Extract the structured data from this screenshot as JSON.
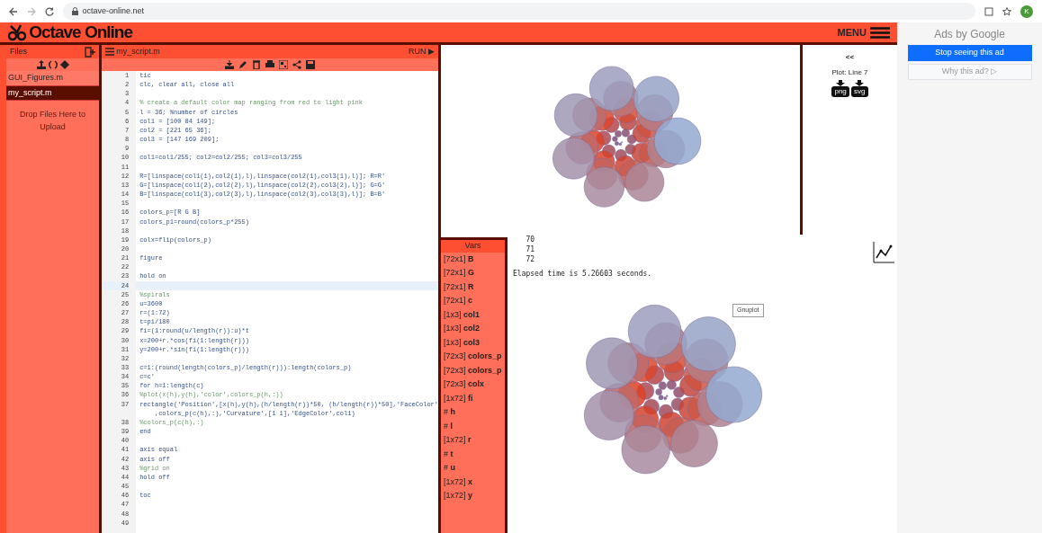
{
  "browser": {
    "url": "octave-online.net",
    "profile_initial": "K"
  },
  "header": {
    "logo": "Octave Online",
    "menu": "MENU"
  },
  "files": {
    "title": "Files",
    "items": [
      {
        "name": "GUI_Figures.m",
        "selected": false
      },
      {
        "name": "my_script.m",
        "selected": true
      }
    ],
    "drop_hint": "Drop Files Here to Upload"
  },
  "editor": {
    "tab": "my_script.m",
    "run": "RUN ▶",
    "lines": [
      {
        "num": "1",
        "kind": "code",
        "text": "tic"
      },
      {
        "num": "2",
        "kind": "code",
        "text": "clc, clear all, close all"
      },
      {
        "num": "3"
      },
      {
        "num": "4",
        "kind": "comment",
        "text": "% create a default color map ranging from red to light pink"
      },
      {
        "num": "5",
        "kind": "code",
        "text": "l = 36; %number of circles"
      },
      {
        "num": "6",
        "kind": "code",
        "text": "col1 = [100 84 149];"
      },
      {
        "num": "7",
        "kind": "code",
        "text": "col2 = [221 65 36];"
      },
      {
        "num": "8",
        "kind": "code",
        "text": "col3 = [147 169 209];"
      },
      {
        "num": "9"
      },
      {
        "num": "10",
        "kind": "code",
        "text": "col1=col1/255; col2=col2/255; col3=col3/255"
      },
      {
        "num": "11"
      },
      {
        "num": "12",
        "kind": "code",
        "text": "R=[linspace(col1(1),col2(1),l),linspace(col2(1),col3(1),l)]; R=R'"
      },
      {
        "num": "13",
        "kind": "code",
        "text": "G=[linspace(col1(2),col2(2),l),linspace(col2(2),col3(2),l)]; G=G'"
      },
      {
        "num": "14",
        "kind": "code",
        "text": "B=[linspace(col1(3),col2(3),l),linspace(col2(3),col3(3),l)]; B=B'"
      },
      {
        "num": "15"
      },
      {
        "num": "16",
        "kind": "code",
        "text": "colors_p=[R G B]"
      },
      {
        "num": "17",
        "kind": "code",
        "text": "colors_p1=round(colors_p*255)"
      },
      {
        "num": "18"
      },
      {
        "num": "19",
        "kind": "code",
        "text": "colx=flip(colors_p)"
      },
      {
        "num": "20"
      },
      {
        "num": "21",
        "kind": "code",
        "text": "figure"
      },
      {
        "num": "22"
      },
      {
        "num": "23",
        "kind": "code",
        "text": "hold on"
      },
      {
        "num": "24",
        "current": true
      },
      {
        "num": "25",
        "kind": "comment",
        "text": "%spirals"
      },
      {
        "num": "26",
        "kind": "code",
        "text": "u=3600"
      },
      {
        "num": "27",
        "kind": "code",
        "text": "r=(1:72)"
      },
      {
        "num": "28",
        "kind": "code",
        "text": "t=pi/180"
      },
      {
        "num": "29",
        "kind": "code",
        "text": "fi=(1:round(u/length(r)):u)*t"
      },
      {
        "num": "30",
        "kind": "code",
        "text": "x=200+r.*cos(fi(1:length(r)))"
      },
      {
        "num": "31",
        "kind": "code",
        "text": "y=200+r.*sin(fi(1:length(r)))"
      },
      {
        "num": "32"
      },
      {
        "num": "33",
        "kind": "code",
        "text": "c=1:(round(length(colors_p)/length(r))):length(colors_p)"
      },
      {
        "num": "34",
        "kind": "code",
        "text": "c=c'"
      },
      {
        "num": "35",
        "kind": "code",
        "text": "for h=1:length(c)"
      },
      {
        "num": "36",
        "kind": "comment",
        "text": "%plot(x(h),y(h),'color',colors_p(h,:))"
      },
      {
        "num": "37",
        "kind": "code",
        "text": "rectangle('Position',[x(h),y(h),(h/length(r))*50, (h/length(r))*50],'FaceColor'",
        "continuation": "    ,colors_p(c(h),:),'Curvature',[1 1],'EdgeColor',col1)"
      },
      {
        "num": "38",
        "kind": "comment",
        "text": "%colors_p(c(h),:)"
      },
      {
        "num": "39",
        "kind": "code",
        "text": "end"
      },
      {
        "num": "40"
      },
      {
        "num": "41",
        "kind": "code",
        "text": "axis equal"
      },
      {
        "num": "42",
        "kind": "code",
        "text": "axis off"
      },
      {
        "num": "43",
        "kind": "comment",
        "text": "%grid on"
      },
      {
        "num": "44",
        "kind": "code",
        "text": "hold off"
      },
      {
        "num": "45"
      },
      {
        "num": "46",
        "kind": "code",
        "text": "toc"
      },
      {
        "num": "47"
      },
      {
        "num": "48"
      },
      {
        "num": "49"
      }
    ]
  },
  "plot_panel": {
    "back": "<<",
    "caption": "Plot: Line 7",
    "downloads": [
      "png",
      "svg"
    ]
  },
  "vars": {
    "title": "Vars",
    "items": [
      {
        "size": "[72x1]",
        "name": "B"
      },
      {
        "size": "[72x1]",
        "name": "G"
      },
      {
        "size": "[72x1]",
        "name": "R"
      },
      {
        "size": "[72x1]",
        "name": "c"
      },
      {
        "size": "[1x3]",
        "name": "col1"
      },
      {
        "size": "[1x3]",
        "name": "col2"
      },
      {
        "size": "[1x3]",
        "name": "col3"
      },
      {
        "size": "[72x3]",
        "name": "colors_p"
      },
      {
        "size": "[72x3]",
        "name": "colors_p"
      },
      {
        "size": "[72x3]",
        "name": "colx"
      },
      {
        "size": "[1x72]",
        "name": "fi"
      },
      {
        "size": "#",
        "name": "h"
      },
      {
        "size": "#",
        "name": "l"
      },
      {
        "size": "[1x72]",
        "name": "r"
      },
      {
        "size": "#",
        "name": "t"
      },
      {
        "size": "#",
        "name": "u"
      },
      {
        "size": "[1x72]",
        "name": "x"
      },
      {
        "size": "[1x72]",
        "name": "y"
      }
    ]
  },
  "console": {
    "lines": [
      {
        "kind": "output",
        "text": "   70"
      },
      {
        "kind": "output",
        "text": "   71"
      },
      {
        "kind": "output",
        "text": "   72"
      },
      {
        "kind": "message",
        "text": "Elapsed time is 5.26603 seconds."
      }
    ],
    "figure_label": "Gnuplot"
  },
  "ads": {
    "title": "Ads by Google",
    "stop": "Stop seeing this ad",
    "why": "Why this ad? ▷"
  }
}
